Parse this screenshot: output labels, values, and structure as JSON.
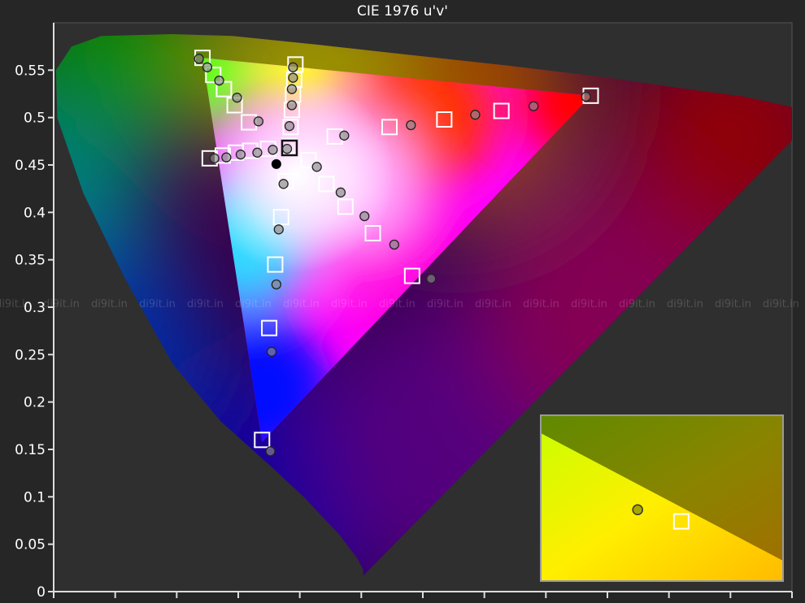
{
  "chart_data": {
    "type": "scatter",
    "title": "CIE 1976 u'v'",
    "xlabel": "",
    "ylabel": "",
    "ylim": [
      0,
      0.6
    ],
    "xlim": [
      0,
      0.62
    ],
    "y_ticks": [
      "0",
      "0.05",
      "0.1",
      "0.15",
      "0.2",
      "0.25",
      "0.3",
      "0.35",
      "0.4",
      "0.45",
      "0.5",
      "0.55"
    ],
    "x_tick_count": 12,
    "grid": false,
    "watermark": "di9it.in",
    "locus": [
      [
        0.26,
        0.017
      ],
      [
        0.26,
        0.023
      ],
      [
        0.255,
        0.035
      ],
      [
        0.24,
        0.06
      ],
      [
        0.21,
        0.1
      ],
      [
        0.18,
        0.135
      ],
      [
        0.14,
        0.18
      ],
      [
        0.1,
        0.24
      ],
      [
        0.06,
        0.33
      ],
      [
        0.025,
        0.42
      ],
      [
        0.003,
        0.5
      ],
      [
        0.002,
        0.55
      ],
      [
        0.015,
        0.575
      ],
      [
        0.04,
        0.586
      ],
      [
        0.1,
        0.588
      ],
      [
        0.15,
        0.586
      ],
      [
        0.22,
        0.577
      ],
      [
        0.3,
        0.566
      ],
      [
        0.38,
        0.555
      ],
      [
        0.46,
        0.543
      ],
      [
        0.52,
        0.532
      ],
      [
        0.58,
        0.522
      ],
      [
        0.62,
        0.511
      ],
      [
        0.62,
        0.476
      ]
    ],
    "gamut": {
      "red": [
        0.451,
        0.523
      ],
      "green": [
        0.125,
        0.563
      ],
      "blue": [
        0.175,
        0.158
      ],
      "white": [
        0.198,
        0.468
      ]
    },
    "targets": [
      [
        0.125,
        0.563
      ],
      [
        0.134,
        0.545
      ],
      [
        0.143,
        0.53
      ],
      [
        0.152,
        0.513
      ],
      [
        0.164,
        0.495
      ],
      [
        0.131,
        0.457
      ],
      [
        0.142,
        0.46
      ],
      [
        0.153,
        0.463
      ],
      [
        0.165,
        0.465
      ],
      [
        0.18,
        0.467
      ],
      [
        0.203,
        0.556
      ],
      [
        0.202,
        0.54
      ],
      [
        0.201,
        0.524
      ],
      [
        0.2,
        0.508
      ],
      [
        0.199,
        0.49
      ],
      [
        0.198,
        0.47
      ],
      [
        0.195,
        0.433
      ],
      [
        0.191,
        0.395
      ],
      [
        0.186,
        0.345
      ],
      [
        0.181,
        0.278
      ],
      [
        0.175,
        0.16
      ],
      [
        0.214,
        0.455
      ],
      [
        0.229,
        0.43
      ],
      [
        0.245,
        0.406
      ],
      [
        0.268,
        0.378
      ],
      [
        0.301,
        0.333
      ],
      [
        0.236,
        0.48
      ],
      [
        0.282,
        0.49
      ],
      [
        0.328,
        0.498
      ],
      [
        0.376,
        0.507
      ],
      [
        0.451,
        0.523
      ]
    ],
    "measured": [
      [
        0.122,
        0.562
      ],
      [
        0.129,
        0.553
      ],
      [
        0.139,
        0.539
      ],
      [
        0.154,
        0.521
      ],
      [
        0.172,
        0.496
      ],
      [
        0.135,
        0.457
      ],
      [
        0.145,
        0.458
      ],
      [
        0.157,
        0.461
      ],
      [
        0.171,
        0.463
      ],
      [
        0.184,
        0.466
      ],
      [
        0.201,
        0.553
      ],
      [
        0.201,
        0.542
      ],
      [
        0.2,
        0.53
      ],
      [
        0.2,
        0.513
      ],
      [
        0.198,
        0.491
      ],
      [
        0.196,
        0.467
      ],
      [
        0.193,
        0.43
      ],
      [
        0.189,
        0.382
      ],
      [
        0.187,
        0.324
      ],
      [
        0.183,
        0.253
      ],
      [
        0.182,
        0.148
      ],
      [
        0.221,
        0.448
      ],
      [
        0.241,
        0.421
      ],
      [
        0.261,
        0.396
      ],
      [
        0.286,
        0.366
      ],
      [
        0.317,
        0.33
      ],
      [
        0.244,
        0.481
      ],
      [
        0.3,
        0.492
      ],
      [
        0.354,
        0.503
      ],
      [
        0.403,
        0.512
      ],
      [
        0.447,
        0.522
      ]
    ],
    "current_point": [
      0.187,
      0.451
    ],
    "inset": {
      "target": [
        0.58,
        0.64
      ],
      "measured": [
        0.4,
        0.57
      ]
    }
  }
}
